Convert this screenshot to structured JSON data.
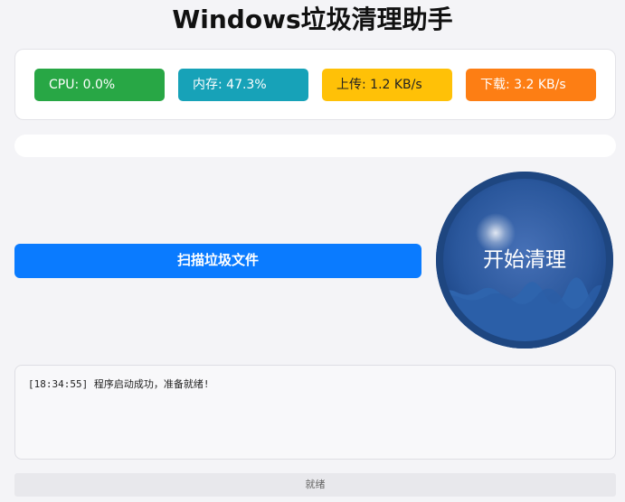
{
  "app": {
    "title": "Windows垃圾清理助手"
  },
  "stats": {
    "cpu": "CPU: 0.0%",
    "memory": "内存: 47.3%",
    "upload": "上传: 1.2 KB/s",
    "download": "下载: 3.2 KB/s"
  },
  "progress": {
    "value": 0
  },
  "actions": {
    "scan_label": "扫描垃圾文件",
    "clean_label": "开始清理"
  },
  "log": {
    "lines": [
      "[18:34:55] 程序启动成功，准备就绪!"
    ]
  },
  "status": {
    "text": "就绪"
  },
  "colors": {
    "cpu": "#28a745",
    "memory": "#17a2b8",
    "upload": "#ffc107",
    "download": "#fd7e14",
    "primary": "#0a7bff",
    "orb": "#1f4f94"
  }
}
